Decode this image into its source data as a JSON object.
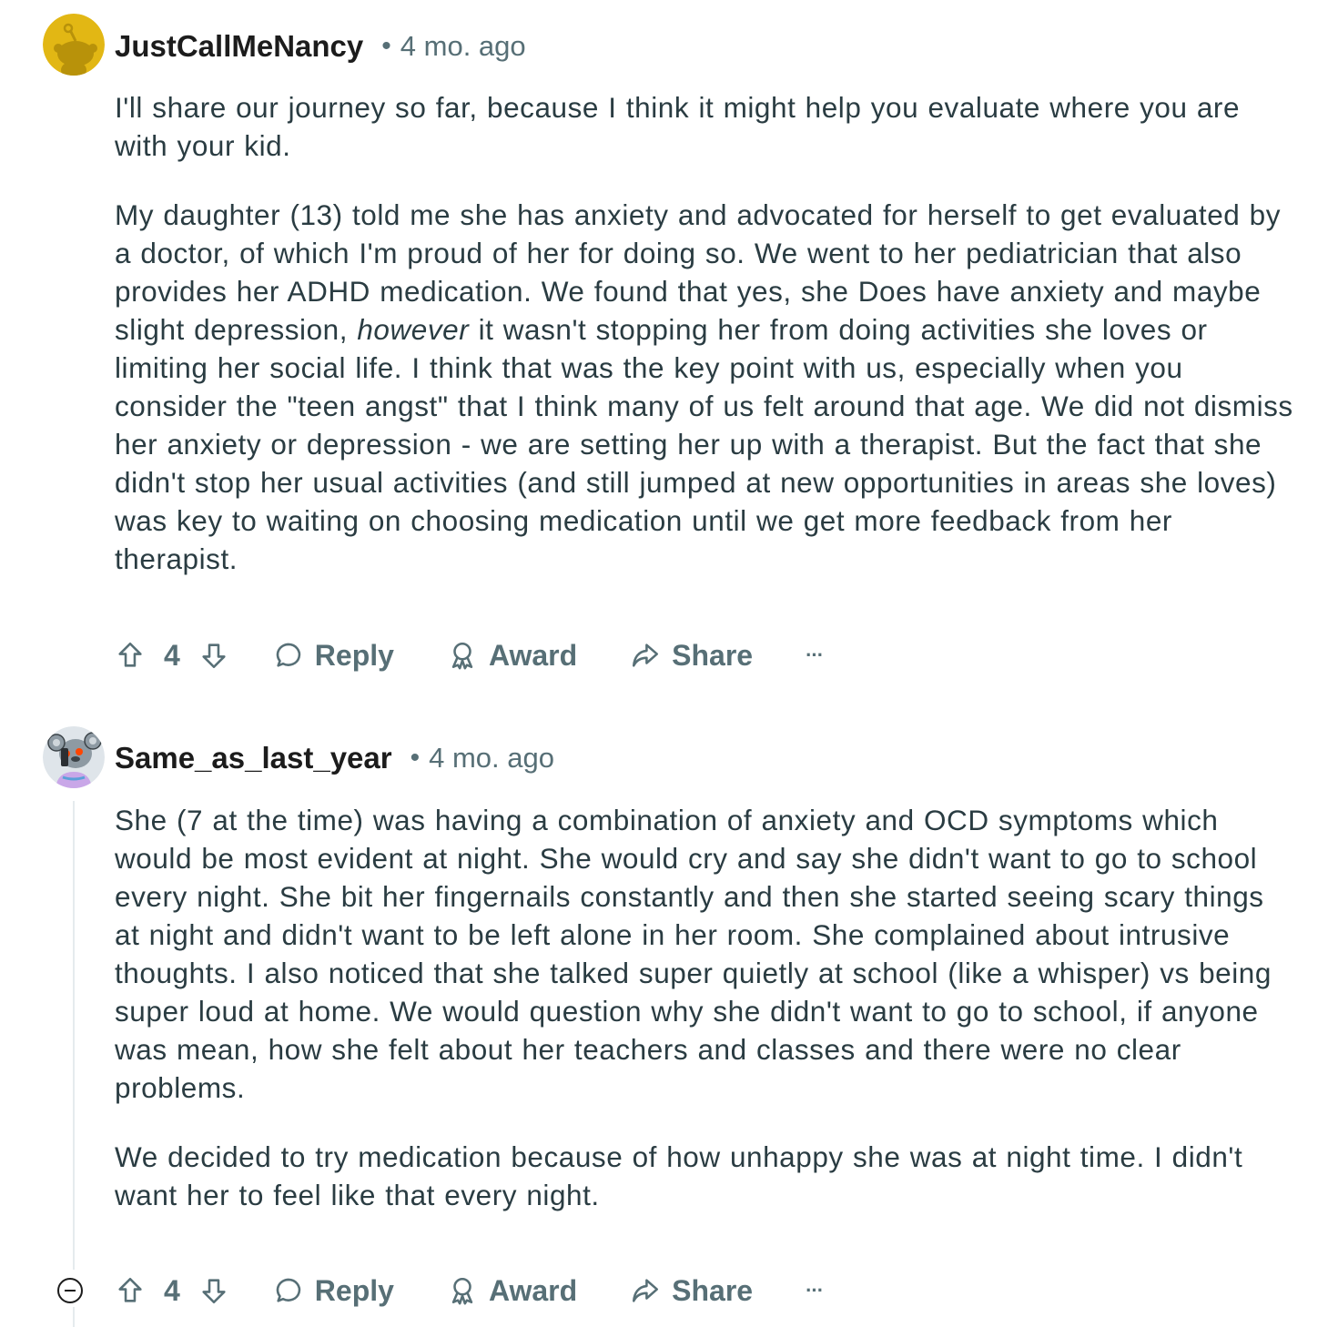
{
  "comments": [
    {
      "username": "JustCallMeNancy",
      "separator": "•",
      "time": "4 mo. ago",
      "paragraphs": [
        {
          "text": "I'll share our journey so far, because I think it might help you evaluate where you are with your kid."
        },
        {
          "pre": "My daughter (13) told me she has anxiety and advocated for herself to get evaluated by a doctor, of which I'm proud of her for doing so. We went to her pediatrician that also provides her ADHD medication. We found that yes, she Does have anxiety and maybe slight depression, ",
          "em": "however",
          "post": " it wasn't stopping her from doing activities she loves or limiting her social life. I think that was the key point with us, especially when you consider the \"teen angst\" that I think many of us felt around that age. We did not dismiss her anxiety or depression - we are setting her up with a therapist. But the fact that she didn't stop her usual activities (and still jumped at new opportunities in areas she loves) was key to waiting on choosing medication until we get more feedback from her therapist."
        }
      ],
      "votes": "4",
      "reply_label": "Reply",
      "award_label": "Award",
      "share_label": "Share",
      "more_label": "···"
    },
    {
      "username": "Same_as_last_year",
      "separator": "•",
      "time": "4 mo. ago",
      "paragraphs": [
        {
          "text": "She (7 at the time) was having a combination of anxiety and OCD symptoms which would be most evident at night. She would cry and say she didn't want to go to school every night. She bit her fingernails constantly and then she started seeing scary things at night and didn't want to be left alone in her room. She complained about intrusive thoughts. I also noticed that she talked super quietly at school (like a whisper) vs being super loud at home. We would question why she didn't want to go to school, if anyone was mean, how she felt about her teachers and classes and there were no clear problems."
        },
        {
          "text": "We decided to try medication because of how unhappy she was at night time. I didn't want her to feel like that every night."
        }
      ],
      "votes": "4",
      "reply_label": "Reply",
      "award_label": "Award",
      "share_label": "Share",
      "more_label": "···"
    }
  ],
  "colors": {
    "text": "#2a3c42",
    "meta": "#576f76",
    "username": "#1c1c1c",
    "thread_line": "#e5ebee",
    "avatar1_bg": "#e2b714",
    "avatar2_bg": "#dfe5ea"
  }
}
